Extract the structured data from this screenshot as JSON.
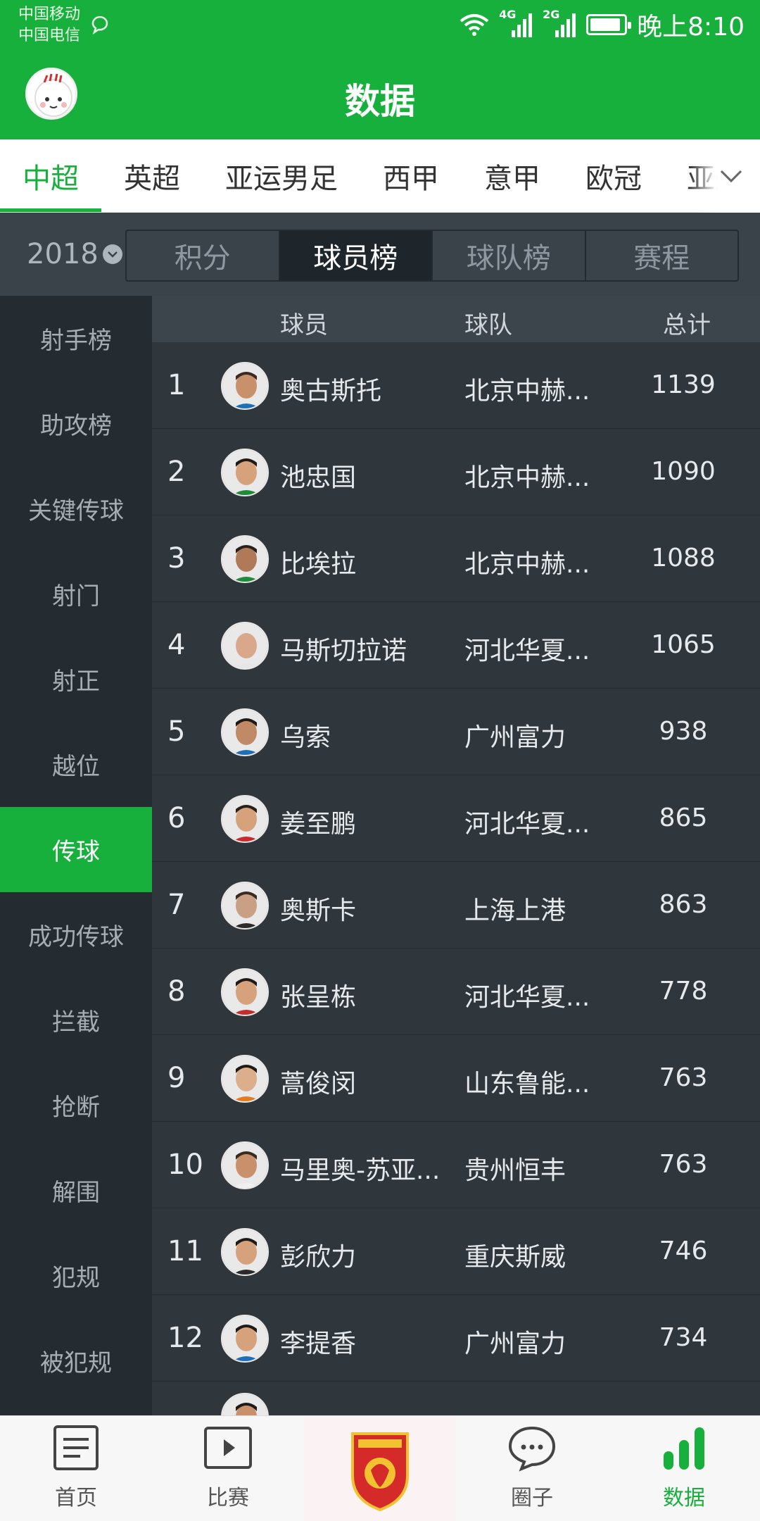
{
  "status_bar": {
    "carrier_1": "中国移动",
    "carrier_2": "中国电信",
    "net_1": "4G",
    "net_2": "2G",
    "time": "晚上8:10"
  },
  "header": {
    "title": "数据"
  },
  "league_tabs": [
    "中超",
    "英超",
    "亚运男足",
    "西甲",
    "意甲",
    "欧冠",
    "亚冠"
  ],
  "year": "2018",
  "view_tabs": [
    "积分",
    "球员榜",
    "球队榜",
    "赛程"
  ],
  "sidebar_items": [
    "射手榜",
    "助攻榜",
    "关键传球",
    "射门",
    "射正",
    "越位",
    "传球",
    "成功传球",
    "拦截",
    "抢断",
    "解围",
    "犯规",
    "被犯规"
  ],
  "table": {
    "headers": {
      "player": "球员",
      "team": "球队",
      "total": "总计"
    },
    "rows": [
      {
        "rank": "1",
        "name": "奥古斯托",
        "team": "北京中赫...",
        "total": "1139"
      },
      {
        "rank": "2",
        "name": "池忠国",
        "team": "北京中赫...",
        "total": "1090"
      },
      {
        "rank": "3",
        "name": "比埃拉",
        "team": "北京中赫...",
        "total": "1088"
      },
      {
        "rank": "4",
        "name": "马斯切拉诺",
        "team": "河北华夏...",
        "total": "1065"
      },
      {
        "rank": "5",
        "name": "乌索",
        "team": "广州富力",
        "total": "938"
      },
      {
        "rank": "6",
        "name": "姜至鹏",
        "team": "河北华夏...",
        "total": "865"
      },
      {
        "rank": "7",
        "name": "奥斯卡",
        "team": "上海上港",
        "total": "863"
      },
      {
        "rank": "8",
        "name": "张呈栋",
        "team": "河北华夏...",
        "total": "778"
      },
      {
        "rank": "9",
        "name": "蒿俊闵",
        "team": "山东鲁能...",
        "total": "763"
      },
      {
        "rank": "10",
        "name": "马里奥-苏亚...",
        "team": "贵州恒丰",
        "total": "763"
      },
      {
        "rank": "11",
        "name": "彭欣力",
        "team": "重庆斯威",
        "total": "746"
      },
      {
        "rank": "12",
        "name": "李提香",
        "team": "广州富力",
        "total": "734"
      }
    ]
  },
  "bottom_nav": {
    "home": "首页",
    "match": "比赛",
    "circle": "圈子",
    "data": "数据"
  },
  "colors": {
    "brand_green": "#17b03d",
    "sidebar_bg": "#252c31",
    "table_bg": "#2f363c"
  }
}
